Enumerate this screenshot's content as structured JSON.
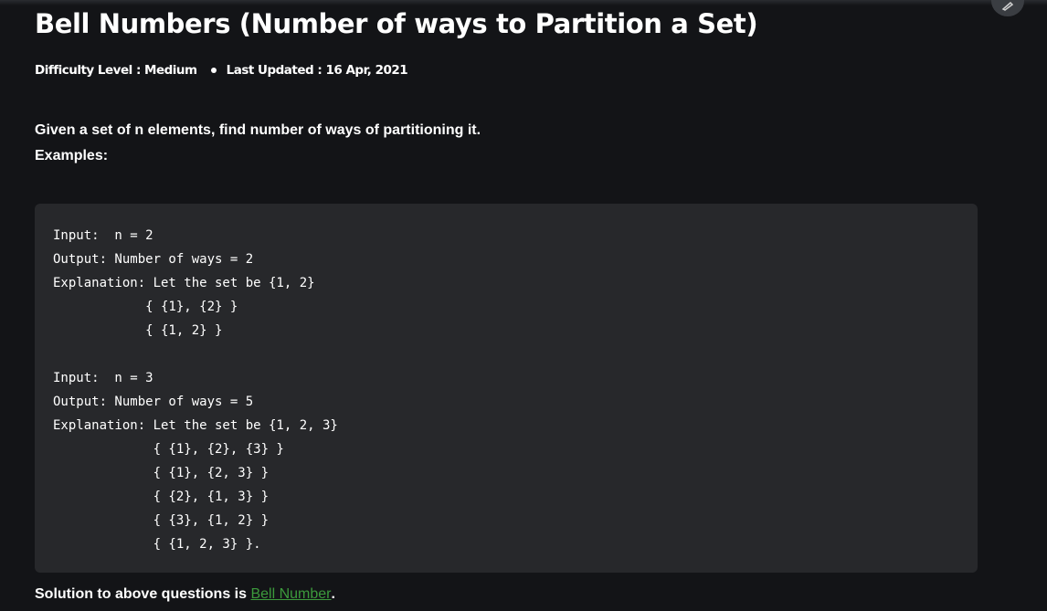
{
  "article": {
    "title": "Bell Numbers (Number of ways to Partition a Set)",
    "difficulty": "Difficulty Level : Medium",
    "last_updated": "Last Updated : 16 Apr, 2021",
    "intro_line": "Given a set of n elements, find number of ways of partitioning it.",
    "examples_label": "Examples:",
    "code_example": "Input:  n = 2\nOutput: Number of ways = 2\nExplanation: Let the set be {1, 2}\n            { {1}, {2} } \n            { {1, 2} }\n\nInput:  n = 3\nOutput: Number of ways = 5\nExplanation: Let the set be {1, 2, 3}\n             { {1}, {2}, {3} }\n             { {1}, {2, 3} }\n             { {2}, {1, 3} }\n             { {3}, {1, 2} }\n             { {1, 2, 3} }.",
    "solution_prefix": "Solution to above questions is ",
    "solution_link": "Bell Number",
    "solution_suffix": "."
  },
  "icons": {
    "edit": "edit-icon"
  },
  "colors": {
    "background": "#131417",
    "code_background": "#27282b",
    "link": "#3c9a3c"
  }
}
